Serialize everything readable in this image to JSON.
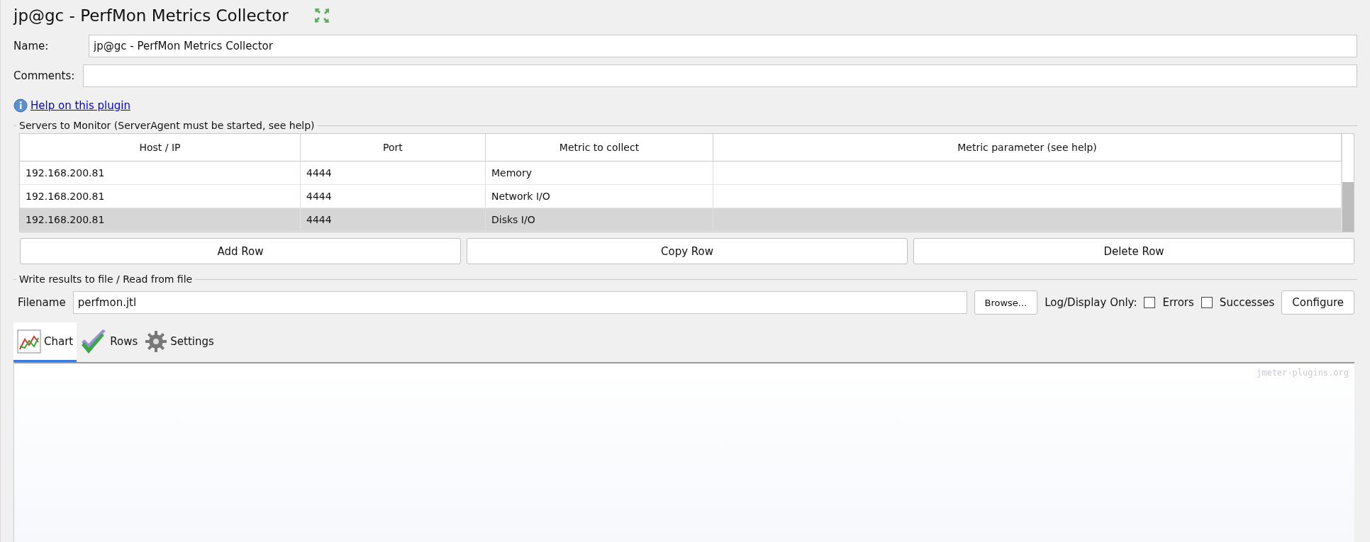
{
  "title": "jp@gc - PerfMon Metrics Collector",
  "name_field": {
    "label": "Name:",
    "value": "jp@gc - PerfMon Metrics Collector"
  },
  "comments_field": {
    "label": "Comments:"
  },
  "help_link": "Help on this plugin",
  "servers": {
    "legend": "Servers to Monitor (ServerAgent must be started, see help)",
    "columns": [
      "Host / IP",
      "Port",
      "Metric to collect",
      "Metric parameter (see help)"
    ],
    "rows": [
      {
        "cells": [
          "192.168.200.81",
          "4444",
          "Memory",
          ""
        ],
        "selected": false
      },
      {
        "cells": [
          "192.168.200.81",
          "4444",
          "Network I/O",
          ""
        ],
        "selected": false
      },
      {
        "cells": [
          "192.168.200.81",
          "4444",
          "Disks I/O",
          ""
        ],
        "selected": true
      }
    ],
    "buttons": [
      "Add Row",
      "Copy Row",
      "Delete Row"
    ]
  },
  "file": {
    "legend": "Write results to file / Read from file",
    "label": "Filename",
    "value": "perfmon.jtl",
    "browse": "Browse...",
    "log_label": "Log/Display Only:",
    "checkboxes": [
      {
        "label": "Errors",
        "checked": false
      },
      {
        "label": "Successes",
        "checked": false
      }
    ],
    "configure": "Configure"
  },
  "tabs": [
    {
      "label": "Chart",
      "kind": "chart",
      "selected": true
    },
    {
      "label": "Rows",
      "kind": "rows",
      "selected": false
    },
    {
      "label": "Settings",
      "kind": "settings",
      "selected": false
    }
  ],
  "chart_credit": "jmeter-plugins.org"
}
